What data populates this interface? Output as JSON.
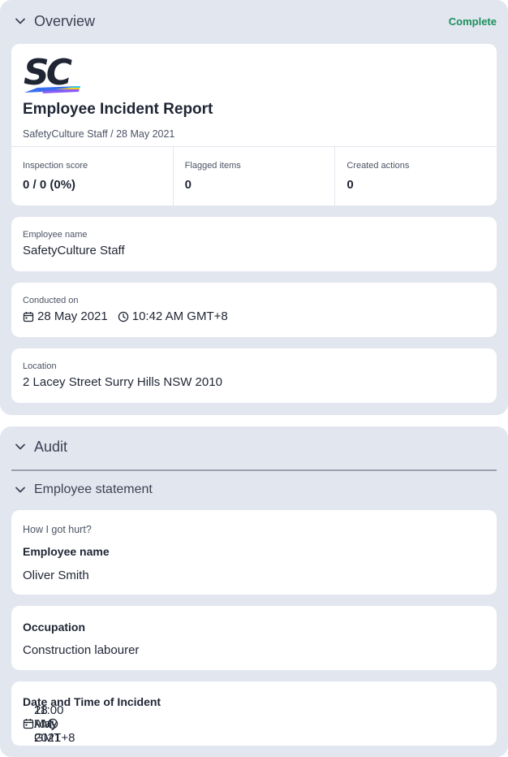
{
  "overview": {
    "title": "Overview",
    "status": "Complete",
    "status_color": "#1a8f5c",
    "logo": {
      "text": "SC",
      "name": "safetyculture-logo"
    },
    "report": {
      "title": "Employee Incident Report",
      "subtitle": "SafetyCulture Staff / 28 May 2021"
    },
    "stats": [
      {
        "label": "Inspection score",
        "value": "0 / 0 (0%)"
      },
      {
        "label": "Flagged items",
        "value": "0"
      },
      {
        "label": "Created actions",
        "value": "0"
      }
    ],
    "employee": {
      "label": "Employee name",
      "value": "SafetyCulture Staff"
    },
    "conducted": {
      "label": "Conducted on",
      "date": "28 May 2021",
      "time": "10:42 AM GMT+8"
    },
    "location": {
      "label": "Location",
      "value": "2 Lacey Street Surry Hills NSW 2010"
    }
  },
  "audit": {
    "title": "Audit",
    "statement": {
      "title": "Employee statement",
      "q1": {
        "question": "How I got hurt?",
        "label": "Employee name",
        "value": "Oliver Smith"
      },
      "q2": {
        "label": "Occupation",
        "value": "Construction labourer"
      },
      "q3": {
        "label": "Date and Time of Incident",
        "date": "28 May 2021",
        "time": "11:00 AM GMT+8"
      }
    }
  },
  "icons": [
    "chevron-down-icon",
    "calendar-icon",
    "clock-icon"
  ],
  "colors": {
    "section_bg": "#e2e6ef",
    "card_bg": "#ffffff"
  }
}
